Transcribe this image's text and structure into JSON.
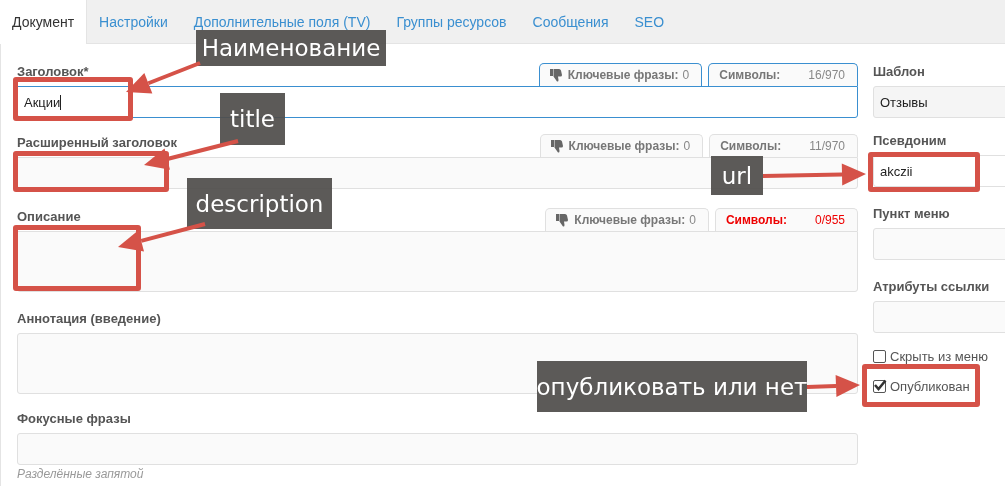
{
  "tabs": [
    {
      "label": "Документ",
      "selected": true
    },
    {
      "label": "Настройки",
      "selected": false
    },
    {
      "label": "Дополнительные поля (TV)",
      "selected": false
    },
    {
      "label": "Группы ресурсов",
      "selected": false
    },
    {
      "label": "Сообщения",
      "selected": false
    },
    {
      "label": "SEO",
      "selected": false
    }
  ],
  "main_fields": [
    {
      "label": "Заголовок*",
      "kind": "input",
      "value": "Акции",
      "focused": true,
      "counters": {
        "keywords_label": "Ключевые фразы:",
        "keywords_value": "0",
        "chars_label": "Символы:",
        "chars_value": "16/970",
        "warning": false
      }
    },
    {
      "label": "Расширенный заголовок",
      "kind": "input",
      "focused": false,
      "counters": {
        "keywords_label": "Ключевые фразы:",
        "keywords_value": "0",
        "chars_label": "Символы:",
        "chars_value": "11/970",
        "warning": false
      }
    },
    {
      "label": "Описание",
      "kind": "textarea",
      "focused": false,
      "counters": {
        "keywords_label": "Ключевые фразы:",
        "keywords_value": "0",
        "chars_label": "Символы:",
        "chars_value": "0/955",
        "warning": true
      }
    },
    {
      "label": "Аннотация (введение)",
      "kind": "textarea",
      "focused": false
    },
    {
      "label": "Фокусные фразы",
      "kind": "input",
      "focused": false,
      "hint": "Разделённые запятой"
    }
  ],
  "side_fields": [
    {
      "label": "Шаблон",
      "kind": "select",
      "value": "Отзывы"
    },
    {
      "label": "Псевдоним",
      "kind": "input",
      "value": "akczii"
    },
    {
      "label": "Пункт меню",
      "kind": "input"
    },
    {
      "label": "Атрибуты ссылки",
      "kind": "input"
    }
  ],
  "checkboxes": [
    {
      "label": "Скрыть из меню",
      "checked": false
    },
    {
      "label": "Опубликован",
      "checked": true
    }
  ],
  "annotations": [
    {
      "text": "Наименование"
    },
    {
      "text": "title"
    },
    {
      "text": "description"
    },
    {
      "text": "url"
    },
    {
      "text": "опубликовать или нет"
    }
  ]
}
